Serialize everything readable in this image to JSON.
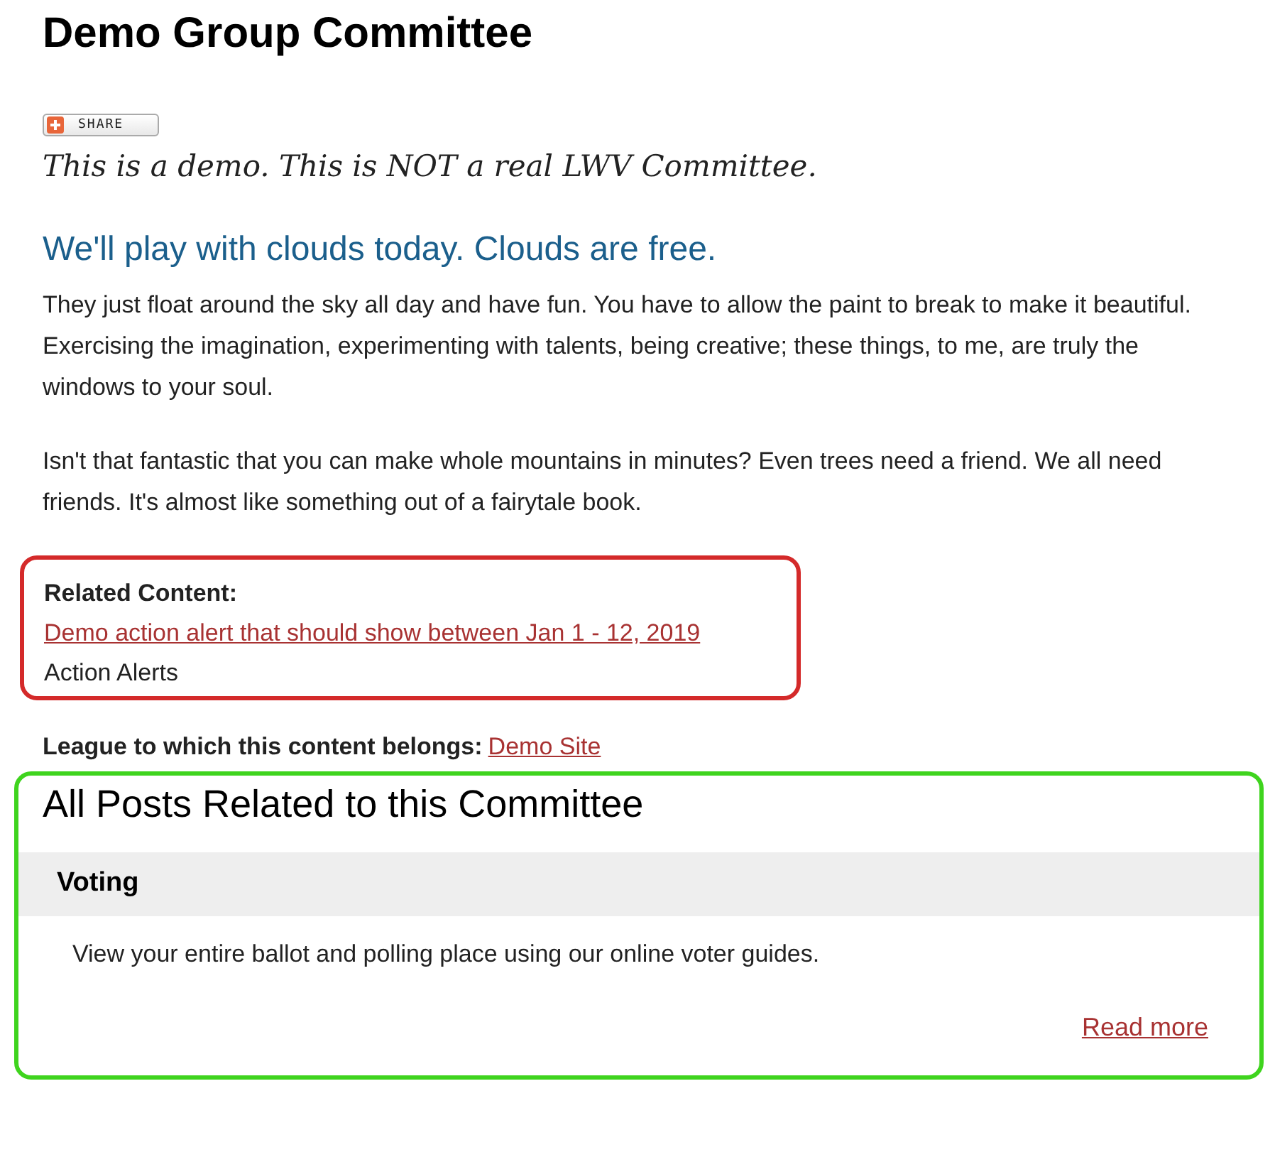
{
  "title": "Demo Group Committee",
  "share_button": {
    "label": "SHARE"
  },
  "disclaimer": "This is a demo. This is NOT a real LWV Committee.",
  "heading": "We'll play with clouds today. Clouds are free.",
  "paragraphs": [
    "They just float around the sky all day and have fun. You have to allow the paint to break to make it beautiful. Exercising the imagination, experimenting with talents, being creative; these things, to me, are truly the windows to your soul.",
    "Isn't that fantastic that you can make whole mountains in minutes? Even trees need a friend. We all need friends. It's almost like something out of a fairytale book."
  ],
  "related_content": {
    "label": "Related Content:",
    "link": "Demo action alert that should show between Jan 1 - 12, 2019",
    "category": "Action Alerts",
    "color": "#d42a2a"
  },
  "league": {
    "label": "League to which this content belongs:",
    "link": "Demo Site"
  },
  "posts_section": {
    "title": "All Posts Related to this Committee",
    "color": "#3fd41e",
    "posts": [
      {
        "title": "Voting",
        "summary": "View your entire ballot and polling place using our online voter guides.",
        "link": "Read more"
      }
    ]
  }
}
